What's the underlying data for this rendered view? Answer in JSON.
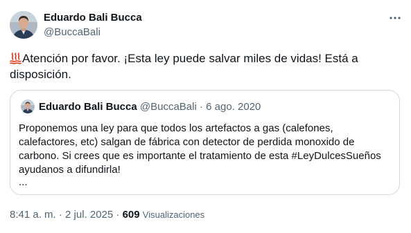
{
  "author": {
    "display_name": "Eduardo Bali Bucca",
    "handle": "@BuccaBali"
  },
  "icons": {
    "more": "more-horizontal-icon",
    "emoji": "hot-springs-emoji-icon",
    "avatar": "profile-photo"
  },
  "tweet": {
    "text": "Atención por favor. ¡Esta ley puede salvar miles de vidas! Está a disposición."
  },
  "quoted": {
    "display_name": "Eduardo Bali Bucca",
    "meta": "@BuccaBali · 6 ago. 2020",
    "text": "Proponemos una ley para que todos los artefactos a gas (calefones, calefactores, etc) salgan de fábrica con detector de perdida monoxido de carbono. Si crees que es importante el tratamiento de esta #LeyDulcesSueños ayudanos a difundirla!",
    "ellipsis": "..."
  },
  "footer": {
    "timestamp": "8:41 a. m. · 2 jul. 2025 · ",
    "views_count": "609",
    "views_label": "Visualizaciones"
  },
  "colors": {
    "text_primary": "#0f1419",
    "text_secondary": "#536471",
    "border": "#cfd9de",
    "emoji": "#e0321b"
  }
}
